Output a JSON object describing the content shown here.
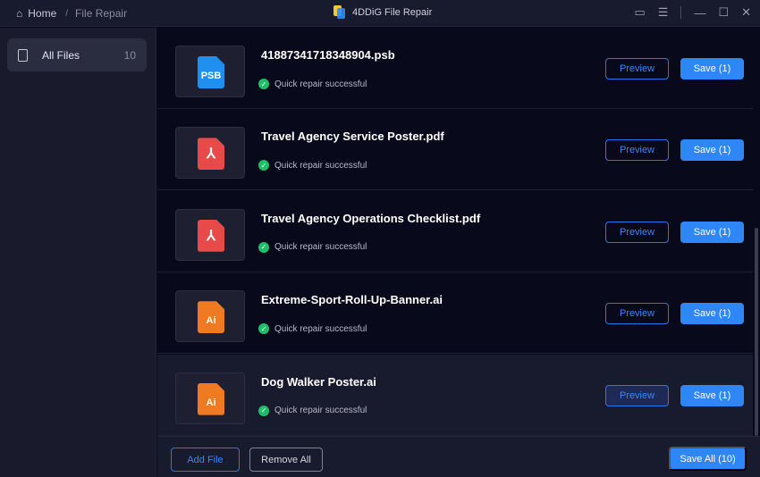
{
  "titlebar": {
    "home": "Home",
    "current": "File Repair",
    "app_title": "4DDiG File Repair"
  },
  "sidebar": {
    "items": [
      {
        "label": "All Files",
        "count": "10"
      }
    ]
  },
  "files": [
    {
      "name": "41887341718348904.psb",
      "type": "PSB",
      "color": "#1f8ff0",
      "status": "Quick repair successful",
      "preview": "Preview",
      "save": "Save (1)"
    },
    {
      "name": "Travel Agency Service Poster.pdf",
      "type": "PDF",
      "color": "#e84a4a",
      "status": "Quick repair successful",
      "preview": "Preview",
      "save": "Save (1)"
    },
    {
      "name": "Travel Agency Operations Checklist.pdf",
      "type": "PDF",
      "color": "#e84a4a",
      "status": "Quick repair successful",
      "preview": "Preview",
      "save": "Save (1)"
    },
    {
      "name": "Extreme-Sport-Roll-Up-Banner.ai",
      "type": "Ai",
      "color": "#f07a22",
      "status": "Quick repair successful",
      "preview": "Preview",
      "save": "Save (1)"
    },
    {
      "name": "Dog Walker Poster.ai",
      "type": "Ai",
      "color": "#f07a22",
      "status": "Quick repair successful",
      "preview": "Preview",
      "save": "Save (1)"
    }
  ],
  "footer": {
    "add_file": "Add File",
    "remove_all": "Remove All",
    "save_all": "Save All (10)"
  }
}
